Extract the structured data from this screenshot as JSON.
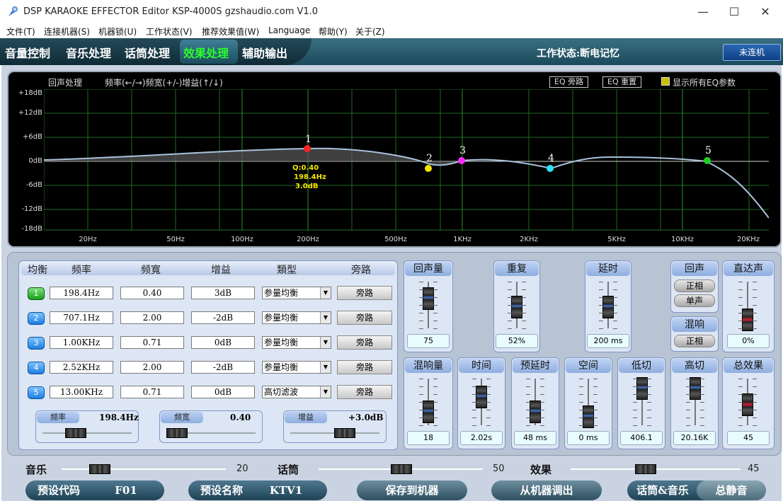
{
  "window": {
    "title": "DSP KARAOKE EFFECTOR Editor KSP-4000S   gzshaudio.com    V1.0",
    "minimize": "—",
    "maximize": "☐",
    "close": "✕"
  },
  "menu": [
    "文件(T)",
    "连接机器(S)",
    "机器锁(U)",
    "工作状态(V)",
    "推荐效果值(W)",
    "Language",
    "帮助(Y)",
    "关于(Z)"
  ],
  "nav": {
    "tabs": [
      "音量控制",
      "音乐处理",
      "话筒处理",
      "效果处理",
      "辅助输出"
    ],
    "active": "效果处理",
    "work_status": "工作状态:断电记忆",
    "connect": "未连机"
  },
  "eq": {
    "title": "回声处理",
    "hint": "频率(←/→)频宽(+/-)增益(↑/↓)",
    "bypass_btn": "EQ 旁路",
    "reset_btn": "EQ 重置",
    "show_all": "显示所有EQ参数",
    "y_ticks": [
      "+18dB",
      "+12dB",
      "+6dB",
      "0dB",
      "-6dB",
      "-12dB",
      "-18dB"
    ],
    "x_ticks": [
      "20Hz",
      "50Hz",
      "100Hz",
      "200Hz",
      "500Hz",
      "1KHz",
      "2KHz",
      "5KHz",
      "10KHz",
      "20KHz"
    ],
    "tooltip": [
      "Q:0.40",
      "198.4Hz",
      "3.0dB"
    ],
    "point_labels": [
      "1",
      "2",
      "3",
      "4",
      "5"
    ]
  },
  "table": {
    "headers": [
      "均衡",
      "频率",
      "频寬",
      "增益",
      "類型",
      "旁路"
    ],
    "rows": [
      {
        "band": "1",
        "freq": "198.4Hz",
        "q": "0.40",
        "gain": "3dB",
        "type": "参量均衡",
        "bypass": "旁路"
      },
      {
        "band": "2",
        "freq": "707.1Hz",
        "q": "2.00",
        "gain": "-2dB",
        "type": "参量均衡",
        "bypass": "旁路"
      },
      {
        "band": "3",
        "freq": "1.00KHz",
        "q": "0.71",
        "gain": "0dB",
        "type": "参量均衡",
        "bypass": "旁路"
      },
      {
        "band": "4",
        "freq": "2.52KHz",
        "q": "2.00",
        "gain": "-2dB",
        "type": "参量均衡",
        "bypass": "旁路"
      },
      {
        "band": "5",
        "freq": "13.00KHz",
        "q": "0.71",
        "gain": "0dB",
        "type": "高切滤波",
        "bypass": "旁路"
      }
    ],
    "freq_label": "频率",
    "freq_value": "198.4Hz",
    "bw_label": "频宽",
    "bw_value": "0.40",
    "gain_label": "增益",
    "gain_value": "+3.0dB"
  },
  "modules": {
    "echo_vol": {
      "title": "回声量",
      "value": "75"
    },
    "repeat": {
      "title": "重复",
      "value": "52%"
    },
    "delay": {
      "title": "延时",
      "value": "200 ms"
    },
    "echo": {
      "title": "回声",
      "btn1": "正相",
      "btn2": "单声"
    },
    "direct": {
      "title": "直达声",
      "value": "0%"
    },
    "reverb": {
      "title": "混响",
      "btn1": "正相"
    },
    "reverb_vol": {
      "title": "混响量",
      "value": "18"
    },
    "time": {
      "title": "时间",
      "value": "2.02s"
    },
    "predelay": {
      "title": "预延时",
      "value": "48 ms"
    },
    "space": {
      "title": "空间",
      "value": "0 ms"
    },
    "lowcut": {
      "title": "低切",
      "value": "406.1"
    },
    "highcut": {
      "title": "高切",
      "value": "20.16K"
    },
    "total": {
      "title": "总效果",
      "value": "45"
    }
  },
  "bottom": {
    "music": "音乐",
    "music_val": "20",
    "mic": "话筒",
    "mic_val": "50",
    "effect": "效果",
    "effect_val": "45",
    "preset_code": "预设代码",
    "preset_code_val": "F01",
    "preset_name": "预设名称",
    "preset_name_val": "KTV1",
    "save": "保存到机器",
    "load": "从机器调出",
    "mic_music": "话筒&音乐",
    "mute": "总静音"
  }
}
